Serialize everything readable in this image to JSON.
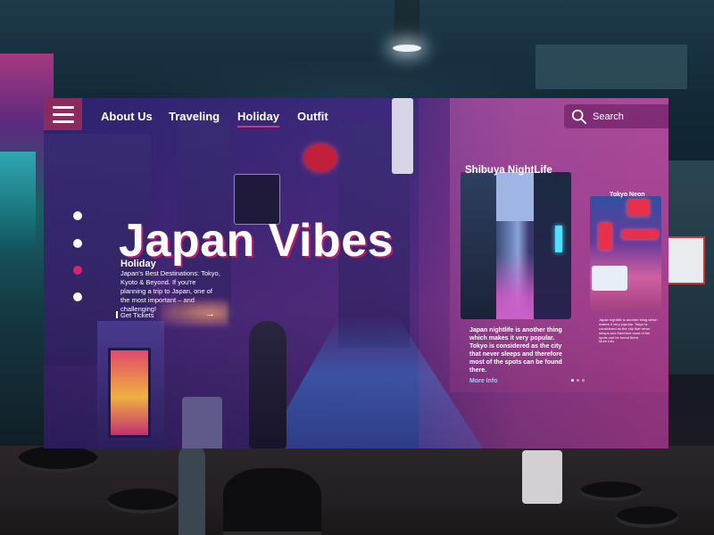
{
  "nav": {
    "items": [
      {
        "label": "About Us",
        "active": false
      },
      {
        "label": "Traveling",
        "active": false
      },
      {
        "label": "Holiday",
        "active": true
      },
      {
        "label": "Outfit",
        "active": false
      }
    ]
  },
  "search": {
    "placeholder": "Search"
  },
  "hero": {
    "title": "Japan Vibes",
    "subtitle": "Holiday",
    "description": "Japan's Best Destinations: Tokyo, Kyoto & Beyond. If you're planning a trip to Japan, one of the most important – and challenging!",
    "cta_label": "Get Tickets",
    "cta_arrow": "→",
    "slide_count": 4,
    "active_slide": 3
  },
  "featured": {
    "title": "Shibuya NightLife",
    "description": "Japan nightlife is another thing which makes it very popular. Tokyo is considered as the city that never sleeps and therefore most of the spots can be found there.",
    "more_label": "More Info",
    "pager_count": 3,
    "pager_active": 1
  },
  "secondary": {
    "title": "Tokyo Neon",
    "description": "Japan nightlife is another thing which makes it very popular. Tokyo is considered as the city that never sleeps and therefore most of the spots can be found there.",
    "more_label": "More Info"
  },
  "colors": {
    "accent": "#d6246e",
    "menu_button": "#8a2a5e",
    "link": "#9ecbff"
  }
}
